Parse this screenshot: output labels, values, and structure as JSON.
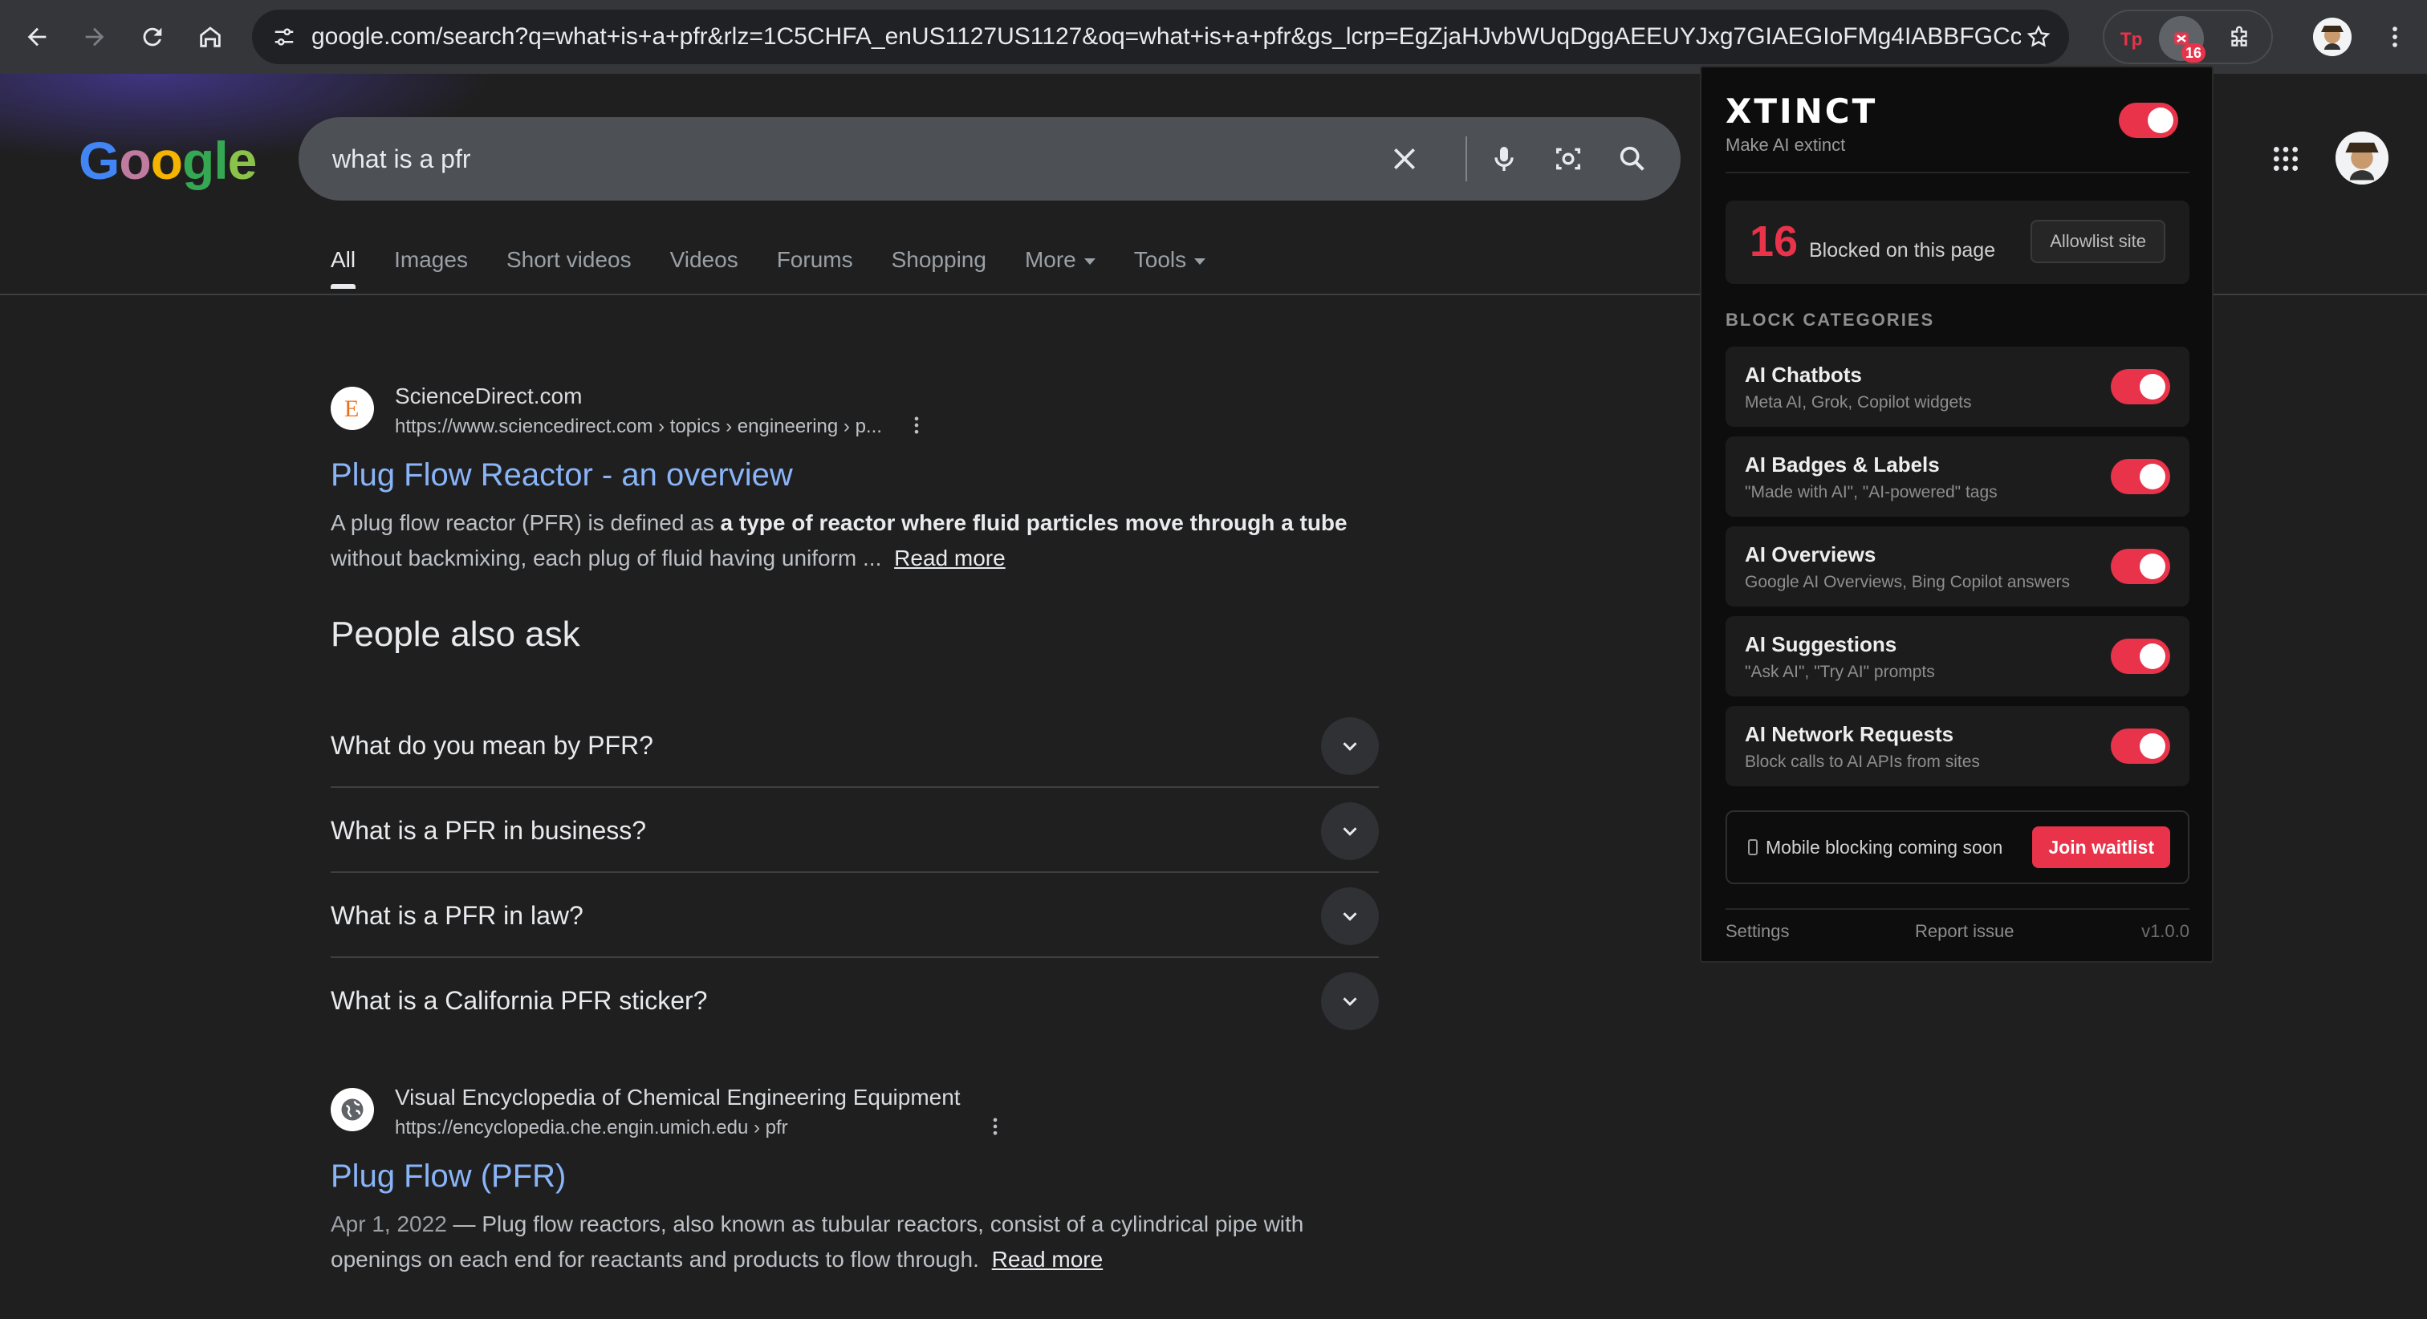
{
  "browser": {
    "url": "google.com/search?q=what+is+a+pfr&rlz=1C5CHFA_enUS1127US1127&oq=what+is+a+pfr&gs_lcrp=EgZjaHJvbWUqDggAEEUYJxg7GIAEGIoFMg4IABBFGCcYO...",
    "extension_badge_count": "16"
  },
  "google": {
    "logo": "Google",
    "query": "what is a pfr",
    "tabs": [
      {
        "label": "All"
      },
      {
        "label": "Images"
      },
      {
        "label": "Short videos"
      },
      {
        "label": "Videos"
      },
      {
        "label": "Forums"
      },
      {
        "label": "Shopping"
      },
      {
        "label": "More"
      },
      {
        "label": "Tools"
      }
    ]
  },
  "results": [
    {
      "site": "ScienceDirect.com",
      "url": "https://www.sciencedirect.com › topics › engineering › p...",
      "title": "Plug Flow Reactor - an overview",
      "snippet_pre": "A plug flow reactor (PFR) is defined as ",
      "snippet_bold": "a type of reactor where fluid particles move through a tube",
      "snippet_post": " without backmixing, each plug of fluid having uniform ... ",
      "read_more": "Read more"
    },
    {
      "site": "Visual Encyclopedia of Chemical Engineering Equipment",
      "url": "https://encyclopedia.che.engin.umich.edu › pfr",
      "title": "Plug Flow (PFR)",
      "date": "Apr 1, 2022",
      "snippet": " — Plug flow reactors, also known as tubular reactors, consist of a cylindrical pipe with openings on each end for reactants and products to flow through. ",
      "read_more": "Read more"
    }
  ],
  "people_also_ask": {
    "title": "People also ask",
    "questions": [
      "What do you mean by PFR?",
      "What is a PFR in business?",
      "What is a PFR in law?",
      "What is a California PFR sticker?"
    ]
  },
  "xtinct": {
    "title": "XTINCT",
    "subtitle": "Make AI extinct",
    "enabled": true,
    "blocked_count": "16",
    "blocked_label": "Blocked on this page",
    "allowlist_label": "Allowlist site",
    "categories_heading": "BLOCK CATEGORIES",
    "categories": [
      {
        "name": "AI Chatbots",
        "desc": "Meta AI, Grok, Copilot widgets",
        "enabled": true
      },
      {
        "name": "AI Badges & Labels",
        "desc": "\"Made with AI\", \"AI-powered\" tags",
        "enabled": true
      },
      {
        "name": "AI Overviews",
        "desc": "Google AI Overviews, Bing Copilot answers",
        "enabled": true
      },
      {
        "name": "AI Suggestions",
        "desc": "\"Ask AI\", \"Try AI\" prompts",
        "enabled": true
      },
      {
        "name": "AI Network Requests",
        "desc": "Block calls to AI APIs from sites",
        "enabled": true
      }
    ],
    "mobile_text": "Mobile blocking coming soon",
    "join_label": "Join waitlist",
    "settings_label": "Settings",
    "report_label": "Report issue",
    "version": "v1.0.0",
    "accent": "#e8334a"
  }
}
